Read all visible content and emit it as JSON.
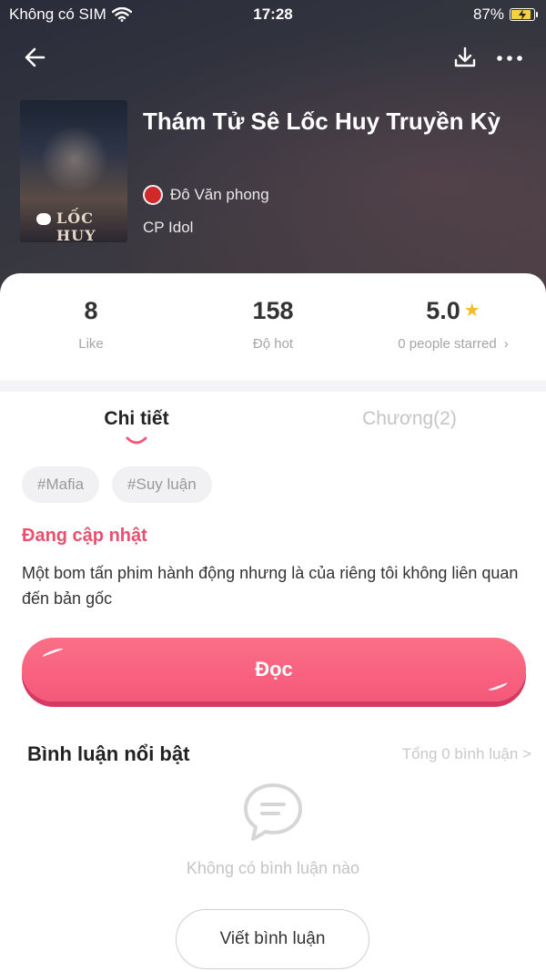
{
  "status_bar": {
    "carrier": "Không có SIM",
    "time": "17:28",
    "battery": "87%",
    "battery_level": 0.87,
    "icons": [
      "wifi-icon",
      "battery-icon",
      "charging-icon"
    ]
  },
  "nav": {
    "icons": [
      "back-arrow-icon",
      "download-icon",
      "more-icon"
    ]
  },
  "book": {
    "title": "Thám Tử Sê Lốc Huy Truyền Kỳ",
    "author": "Đô Văn phong",
    "category": "CP Idol",
    "cover_logo": "LỐC HUY"
  },
  "stats": {
    "likes": {
      "value": "8",
      "label": "Like"
    },
    "hot": {
      "value": "158",
      "label": "Độ hot"
    },
    "rating": {
      "value": "5.0",
      "label": "0 people starred",
      "chevron": "›"
    }
  },
  "tabs": [
    {
      "label": "Chi tiết",
      "active": true
    },
    {
      "label": "Chương(2)",
      "active": false
    }
  ],
  "tags": [
    "#Mafia",
    "#Suy luận"
  ],
  "detail": {
    "status": "Đang cập nhật",
    "description": "Một bom tấn phim hành động nhưng là của riêng tôi không liên quan đến bản gốc"
  },
  "read_button": {
    "label": "Đọc"
  },
  "comments": {
    "title": "Bình luận nổi bật",
    "total": "Tổng 0 bình luận >",
    "empty": "Không có bình luận nào",
    "write_label": "Viết bình luận"
  },
  "colors": {
    "accent": "#f5587a",
    "status_text": "#e8506e",
    "star": "#f5b92d"
  }
}
